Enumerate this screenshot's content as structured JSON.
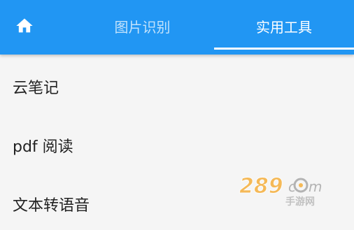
{
  "tabbar": {
    "background": "#2196f3",
    "home_icon": "home-icon",
    "tabs": [
      {
        "label": "图片识别",
        "active": false
      },
      {
        "label": "实用工具",
        "active": true
      }
    ]
  },
  "list": {
    "items": [
      {
        "label": "云笔记"
      },
      {
        "label": "pdf 阅读"
      },
      {
        "label": "文本转语音"
      }
    ]
  },
  "watermark": {
    "text": "289.com",
    "subtext": "手游网"
  }
}
